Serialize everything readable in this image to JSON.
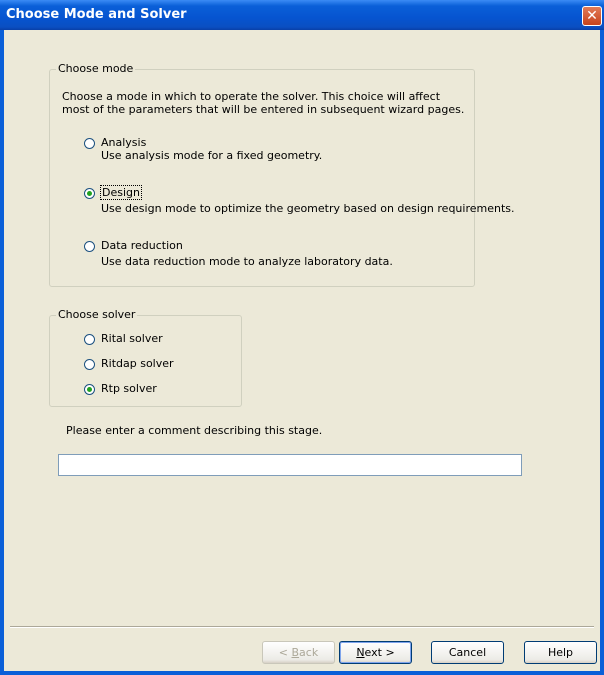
{
  "window": {
    "title": "Choose Mode and Solver",
    "close_glyph": "✕"
  },
  "mode_group": {
    "legend": "Choose mode",
    "description_line1": "Choose a mode in which to operate the solver. This choice will affect",
    "description_line2": "most of the parameters that will be entered in subsequent wizard pages.",
    "options": [
      {
        "label": "Analysis",
        "description": "Use analysis mode for a fixed geometry.",
        "selected": false
      },
      {
        "label": "Design",
        "description": "Use design mode to optimize the geometry based on design requirements.",
        "selected": true
      },
      {
        "label": "Data reduction",
        "description": "Use data reduction mode to analyze laboratory data.",
        "selected": false
      }
    ]
  },
  "solver_group": {
    "legend": "Choose solver",
    "options": [
      {
        "label": "Rital solver",
        "selected": false
      },
      {
        "label": "Ritdap solver",
        "selected": false
      },
      {
        "label": "Rtp solver",
        "selected": true
      }
    ]
  },
  "comment": {
    "prompt": "Please enter a comment describing this stage.",
    "value": ""
  },
  "buttons": {
    "back_prefix": "< ",
    "back_key": "B",
    "back_rest": "ack",
    "next_key": "N",
    "next_rest": "ext >",
    "cancel": "Cancel",
    "help": "Help"
  }
}
